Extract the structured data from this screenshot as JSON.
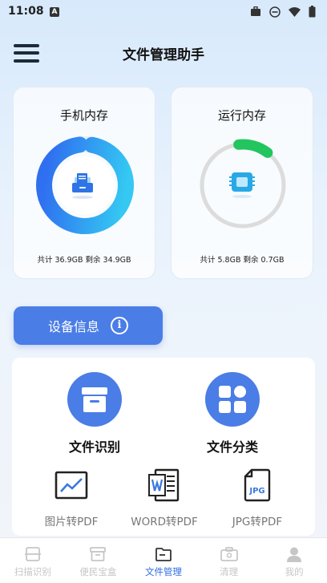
{
  "status_bar": {
    "time": "11:08",
    "indicator": "A",
    "icons": [
      "briefcase-icon",
      "dnd-icon",
      "wifi-icon",
      "battery-icon"
    ]
  },
  "header": {
    "title": "文件管理助手",
    "menu_icon": "menu-icon"
  },
  "storage_cards": [
    {
      "title": "手机内存",
      "stats": "共计 36.9GB  剩余 34.9GB",
      "used_fraction": 0.95,
      "icon": "folder-icon"
    },
    {
      "title": "运行内存",
      "stats": "共计 5.8GB  剩余 0.7GB",
      "used_fraction": 0.12,
      "icon": "chip-icon"
    }
  ],
  "device_button": {
    "label": "设备信息",
    "icon": "i"
  },
  "tools": {
    "primary": [
      {
        "label": "文件识别",
        "icon": "archive-box-icon"
      },
      {
        "label": "文件分类",
        "icon": "grid-icon"
      }
    ],
    "secondary": [
      {
        "label": "图片转PDF",
        "icon": "image-icon"
      },
      {
        "label": "WORD转PDF",
        "icon": "word-icon"
      },
      {
        "label": "JPG转PDF",
        "icon": "jpg-file-icon",
        "badge": "JPG"
      }
    ]
  },
  "tabbar": [
    {
      "label": "扫描识别",
      "icon": "scan-icon",
      "active": false
    },
    {
      "label": "便民宝盒",
      "icon": "box-icon",
      "active": false
    },
    {
      "label": "文件管理",
      "icon": "folder-tab-icon",
      "active": true
    },
    {
      "label": "清理",
      "icon": "toolbox-icon",
      "active": false
    },
    {
      "label": "我的",
      "icon": "user-icon",
      "active": false
    }
  ],
  "colors": {
    "accent": "#4a7de6",
    "active_tab": "#2f6de0",
    "ram_arc": "#22c55e"
  }
}
